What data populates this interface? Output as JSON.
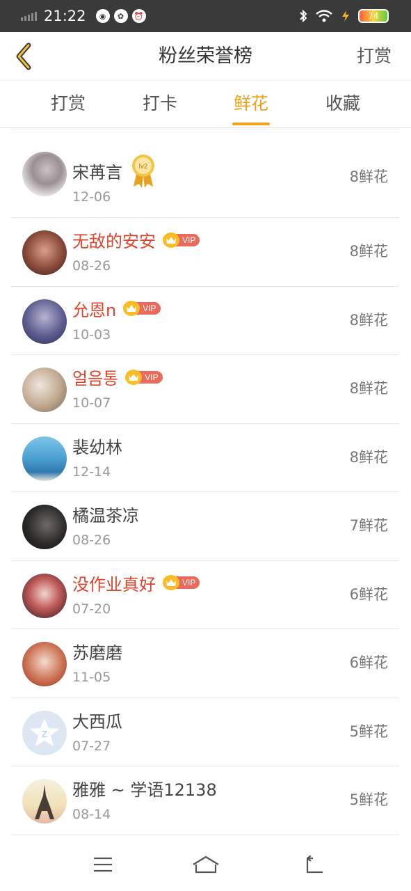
{
  "status_bar": {
    "time": "21:22",
    "battery": "74"
  },
  "header": {
    "title": "粉丝荣誉榜",
    "action_label": "打赏"
  },
  "tabs": [
    {
      "label": "打赏",
      "active": false
    },
    {
      "label": "打卡",
      "active": false
    },
    {
      "label": "鲜花",
      "active": true
    },
    {
      "label": "收藏",
      "active": false
    }
  ],
  "colors": {
    "accent": "#f0a21c",
    "vip_name": "#e0432c",
    "vip_badge": "#e96b5c",
    "crown": "#fbbd25"
  },
  "medal_label": "lv2",
  "vip_badge_text": "VIP",
  "rows": [
    {
      "name": "宋苒言",
      "date": "12-06",
      "count": "8鲜花",
      "vip": false,
      "medal": true
    },
    {
      "name": "无敌的安安",
      "date": "08-26",
      "count": "8鲜花",
      "vip": true,
      "medal": false
    },
    {
      "name": "允恩n",
      "date": "10-03",
      "count": "8鲜花",
      "vip": true,
      "medal": false
    },
    {
      "name": "얼음통",
      "date": "10-07",
      "count": "8鲜花",
      "vip": true,
      "medal": false
    },
    {
      "name": "裴幼林",
      "date": "12-14",
      "count": "8鲜花",
      "vip": false,
      "medal": false
    },
    {
      "name": "橘温茶凉",
      "date": "08-26",
      "count": "7鲜花",
      "vip": false,
      "medal": false
    },
    {
      "name": "没作业真好",
      "date": "07-20",
      "count": "6鲜花",
      "vip": true,
      "medal": false
    },
    {
      "name": "苏磨磨",
      "date": "11-05",
      "count": "6鲜花",
      "vip": false,
      "medal": false
    },
    {
      "name": "大西瓜",
      "date": "07-27",
      "count": "5鲜花",
      "vip": false,
      "medal": false
    },
    {
      "name": "雅雅 ~ 学语12138",
      "date": "08-14",
      "count": "5鲜花",
      "vip": false,
      "medal": false
    }
  ]
}
